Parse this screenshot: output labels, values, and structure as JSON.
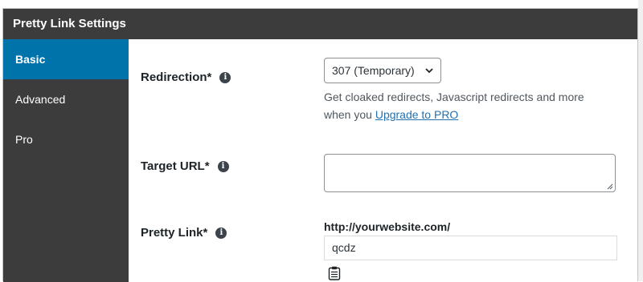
{
  "panel": {
    "title": "Pretty Link Settings"
  },
  "sidebar": {
    "items": [
      {
        "label": "Basic",
        "active": true
      },
      {
        "label": "Advanced",
        "active": false
      },
      {
        "label": "Pro",
        "active": false
      }
    ]
  },
  "fields": {
    "redirection": {
      "label": "Redirection*",
      "info_icon": "info-icon",
      "selected_value": "307 (Temporary)",
      "help_text": "Get cloaked redirects, Javascript redirects and more when you ",
      "help_link": "Upgrade to PRO"
    },
    "target_url": {
      "label": "Target URL*",
      "info_icon": "info-icon",
      "value": ""
    },
    "pretty_link": {
      "label": "Pretty Link*",
      "info_icon": "info-icon",
      "base_url": "http://yourwebsite.com/",
      "slug": "qcdz",
      "copy_icon": "clipboard-icon"
    }
  },
  "colors": {
    "header_bg": "#3c3c3c",
    "sidebar_bg": "#3c3c3c",
    "active_item_bg": "#0073aa",
    "link": "#2271b1"
  }
}
